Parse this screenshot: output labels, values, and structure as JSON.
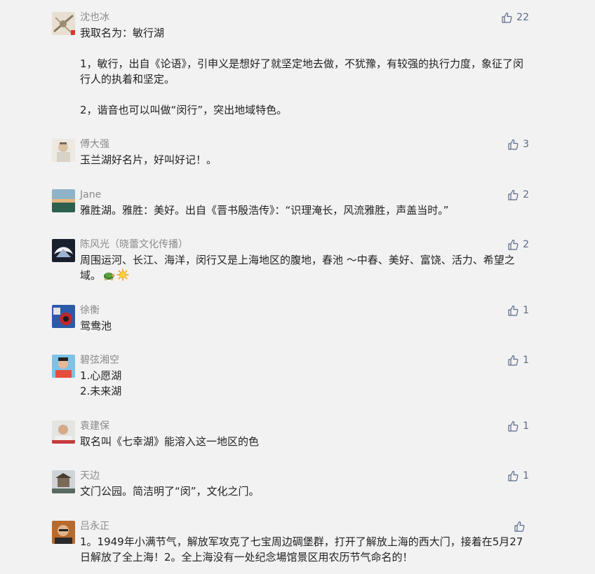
{
  "comments": [
    {
      "name": "沈也冰",
      "likes": "22",
      "lines": [
        "我取名为：敏行湖",
        "1，敏行，出自《论语》，引申义是想好了就坚定地去做，不犹豫，有较强的执行力度，象征了闵行人的执着和坚定。",
        "2，谐音也可以叫做“闵行”，突出地域特色。"
      ]
    },
    {
      "name": "傅大强",
      "likes": "3",
      "lines": [
        "玉兰湖好名片，好叫好记！。"
      ]
    },
    {
      "name": "Jane",
      "likes": "2",
      "lines": [
        "雅胜湖。雅胜：美好。出自《晋书殷浩传》：“识理淹长，风流雅胜，声盖当时。”"
      ]
    },
    {
      "name": "陈风光（晓蕾文化传播）",
      "likes": "2",
      "lines": [
        "周围运河、长江、海洋，闵行又是上海地区的腹地，春池 ～中春、美好、富饶、活力、希望之域。"
      ],
      "emojis": [
        "turtle-emoji",
        "sun-emoji"
      ]
    },
    {
      "name": "徐衡",
      "likes": "1",
      "lines": [
        "鸳鸯池"
      ]
    },
    {
      "name": "碧弦湘空",
      "likes": "1",
      "lines": [
        "1.心愿湖",
        "2.未来湖"
      ]
    },
    {
      "name": "袁建保",
      "likes": "1",
      "lines": [
        "取名叫《七幸湖》能溶入这一地区的色"
      ]
    },
    {
      "name": "天边",
      "likes": "1",
      "lines": [
        "文门公园。简洁明了“闵”，文化之门。"
      ]
    },
    {
      "name": "吕永正",
      "likes": "",
      "lines": [
        "1。1949年小满节气，解放军攻克了七宝周边碉堡群，打开了解放上海的西大门，接着在5月27日解放了全上海！2。全上海没有一处纪念場馆景区用农历节气命名的！"
      ]
    }
  ],
  "colors": {
    "background": "#f2f2f2",
    "name": "#8a8a8a",
    "text": "#222222",
    "like": "#5a6a8a"
  },
  "icons": {
    "like": "thumbs-up-icon"
  }
}
